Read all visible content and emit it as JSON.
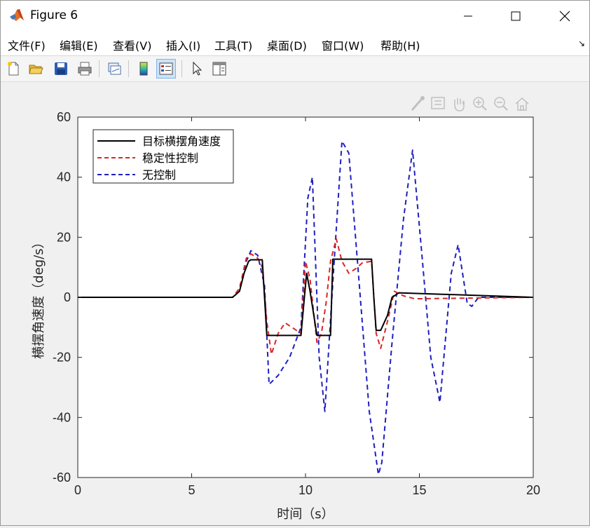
{
  "window": {
    "title": "Figure 6",
    "controls": {
      "minimize": "minimize",
      "maximize": "maximize",
      "close": "close"
    }
  },
  "menu": [
    {
      "label": "文件(F)"
    },
    {
      "label": "编辑(E)"
    },
    {
      "label": "查看(V)"
    },
    {
      "label": "插入(I)"
    },
    {
      "label": "工具(T)"
    },
    {
      "label": "桌面(D)"
    },
    {
      "label": "窗口(W)"
    },
    {
      "label": "帮助(H)"
    }
  ],
  "toolbar": {
    "buttons": [
      "new-figure-icon",
      "open-file-icon",
      "save-icon",
      "print-icon",
      "link-plot-icon",
      "insert-colorbar-icon",
      "insert-legend-icon",
      "edit-plot-icon",
      "property-inspector-icon"
    ]
  },
  "axes_toolbar": [
    "brush-icon",
    "data-tip-icon",
    "pan-icon",
    "zoom-in-icon",
    "zoom-out-icon",
    "home-icon"
  ],
  "colors": {
    "target": "#000000",
    "stability": "#d62728",
    "none": "#1f1fbf"
  },
  "chart_data": {
    "type": "line",
    "xlabel": "时间（s）",
    "ylabel": "横摆角速度（deg/s）",
    "xlim": [
      0,
      20
    ],
    "ylim": [
      -60,
      60
    ],
    "xticks": [
      0,
      5,
      10,
      15,
      20
    ],
    "yticks": [
      -60,
      -40,
      -20,
      0,
      20,
      40,
      60
    ],
    "legend_position": "top-left",
    "grid": false,
    "series": [
      {
        "name": "目标横摆角速度",
        "color": "#000000",
        "style": "solid",
        "x": [
          0,
          6.8,
          7.1,
          7.3,
          7.5,
          7.6,
          8.1,
          8.2,
          8.3,
          9.8,
          9.95,
          10.05,
          10.2,
          10.5,
          10.6,
          11.1,
          11.2,
          12.9,
          13.0,
          13.1,
          13.3,
          13.6,
          13.8,
          14.1,
          20
        ],
        "y": [
          0,
          0,
          2,
          8,
          12,
          12.5,
          12.5,
          0,
          -12.7,
          -12.7,
          0,
          8,
          2,
          -12.7,
          -12.7,
          -12.7,
          12.7,
          12.7,
          0,
          -11,
          -11,
          -6,
          0,
          1.5,
          0
        ]
      },
      {
        "name": "稳定性控制",
        "color": "#d62728",
        "style": "dashed",
        "x": [
          0,
          6.8,
          7.1,
          7.4,
          7.6,
          7.9,
          8.1,
          8.3,
          8.5,
          8.8,
          9.1,
          9.4,
          9.8,
          10.0,
          10.2,
          10.5,
          10.7,
          10.9,
          11.1,
          11.35,
          11.6,
          11.9,
          12.2,
          12.5,
          12.9,
          13.1,
          13.3,
          13.6,
          13.9,
          14.3,
          14.8,
          20
        ],
        "y": [
          0,
          0,
          3,
          13,
          14.5,
          13,
          10,
          -8,
          -19,
          -12,
          -8.5,
          -10,
          -12,
          12,
          6,
          -15,
          -12,
          -2,
          12,
          19.5,
          12,
          8,
          9.5,
          11.5,
          12,
          -12,
          -17,
          -8,
          2,
          0.5,
          -0.5,
          0
        ]
      },
      {
        "name": "无控制",
        "color": "#1f1fbf",
        "style": "dashed",
        "x": [
          0,
          6.8,
          7.1,
          7.4,
          7.6,
          7.9,
          8.2,
          8.4,
          8.8,
          9.3,
          9.8,
          10.1,
          10.3,
          10.6,
          10.85,
          11.2,
          11.6,
          11.9,
          12.3,
          12.8,
          13.2,
          13.35,
          13.8,
          14.3,
          14.7,
          15.1,
          15.5,
          15.9,
          16.4,
          16.7,
          17.1,
          17.3,
          17.6,
          20
        ],
        "y": [
          0,
          0,
          3,
          12,
          15.5,
          14,
          4,
          -29,
          -26,
          -20,
          -10,
          33,
          40,
          -20,
          -38,
          5,
          52,
          48,
          10,
          -38,
          -59,
          -55,
          -15,
          26,
          49,
          15,
          -20,
          -35,
          8,
          17.5,
          -2,
          -3,
          0,
          0
        ]
      }
    ]
  }
}
